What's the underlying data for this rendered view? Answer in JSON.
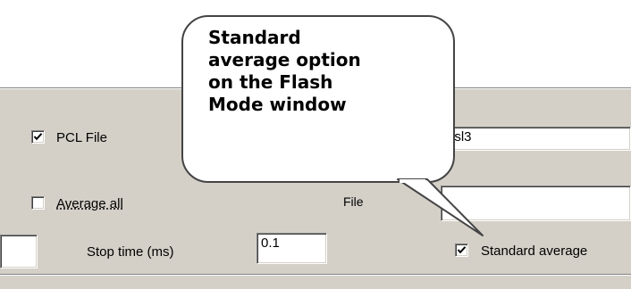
{
  "callout": {
    "text": "Standard\naverage option\non the Flash\nMode window"
  },
  "form": {
    "pcl_file": {
      "label": "PCL File",
      "checked": true
    },
    "pcl_file_value": "nsl3",
    "average_all": {
      "label": "Average all",
      "checked": false
    },
    "file_label": "File",
    "file_value": "",
    "stop_time": {
      "label": "Stop time (ms)",
      "value": "0.1"
    },
    "standard_average": {
      "label": "Standard average",
      "checked": true
    }
  }
}
